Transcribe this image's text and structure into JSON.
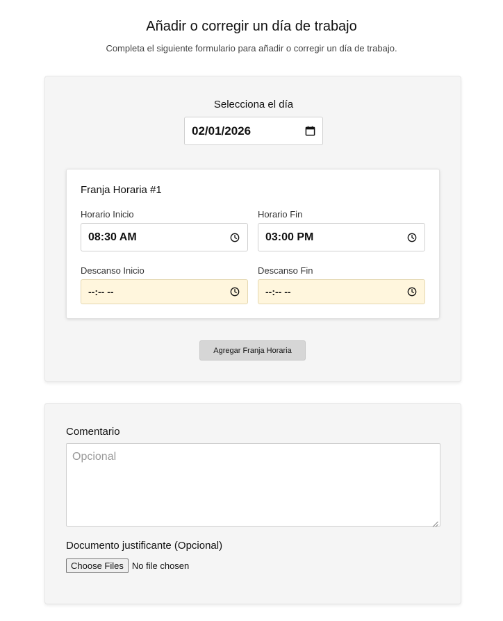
{
  "header": {
    "title": "Añadir o corregir un día de trabajo",
    "subtitle": "Completa el siguiente formulario para añadir o corregir un día de trabajo."
  },
  "day_section": {
    "label": "Selecciona el día",
    "date_value": "02/01/2026",
    "slot": {
      "title": "Franja Horaria #1",
      "start_label": "Horario Inicio",
      "start_value": "08:30 AM",
      "end_label": "Horario Fin",
      "end_value": "03:00 PM",
      "break_start_label": "Descanso Inicio",
      "break_start_value": "--:-- --",
      "break_end_label": "Descanso Fin",
      "break_end_value": "--:-- --"
    },
    "add_slot_label": "Agregar Franja Horaria"
  },
  "comment_section": {
    "label": "Comentario",
    "placeholder": "Opcional",
    "document_label": "Documento justificante (Opcional)",
    "choose_files_label": "Choose Files",
    "file_status": "No file chosen"
  },
  "icons": {
    "date": "calendar-icon",
    "time": "clock-icon"
  }
}
